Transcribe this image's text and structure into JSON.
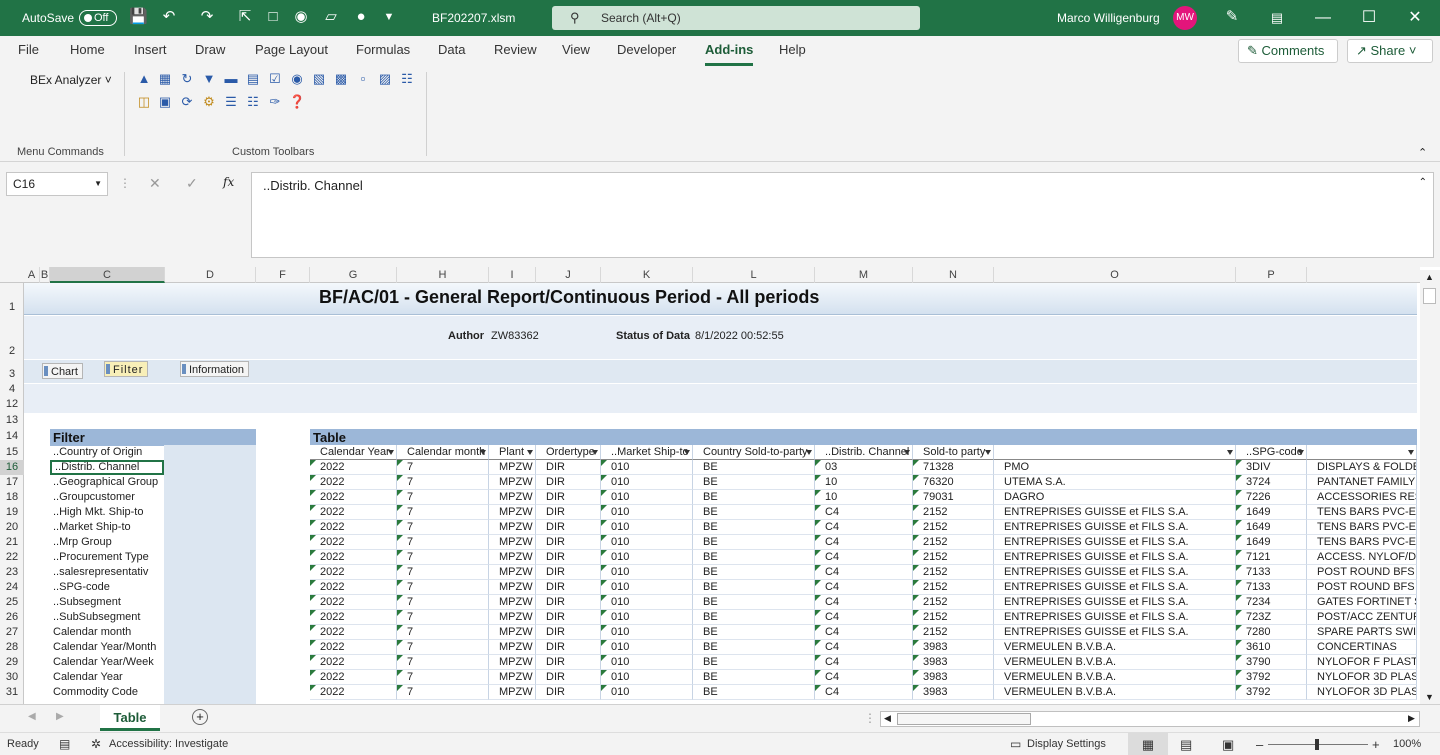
{
  "titlebar": {
    "autosave": "AutoSave",
    "autosave_state": "Off",
    "filename": "BF202207.xlsm",
    "search": "Search (Alt+Q)",
    "user": "Marco Willigenburg",
    "initials": "MW"
  },
  "ribbon": {
    "tabs": [
      "File",
      "Home",
      "Insert",
      "Draw",
      "Page Layout",
      "Formulas",
      "Data",
      "Review",
      "View",
      "Developer",
      "Add-ins",
      "Help"
    ],
    "active_tab": "Add-ins",
    "comments": "Comments",
    "share": "Share",
    "bex": "BEx Analyzer",
    "group1": "Menu Commands",
    "group2": "Custom Toolbars"
  },
  "formula": {
    "namebox": "C16",
    "content": "..Distrib. Channel"
  },
  "columns": [
    "A",
    "B",
    "C",
    "D",
    "F",
    "G",
    "H",
    "I",
    "J",
    "K",
    "L",
    "M",
    "N",
    "O",
    "P"
  ],
  "rows": [
    "1",
    "2",
    "3",
    "4",
    "12",
    "13",
    "14",
    "15",
    "16",
    "17",
    "18",
    "19",
    "20",
    "21",
    "22",
    "23",
    "24",
    "25",
    "26",
    "27",
    "28",
    "29",
    "30",
    "31"
  ],
  "report": {
    "title": "BF/AC/01 - General Report/Continuous Period - All periods",
    "author_label": "Author",
    "author": "ZW83362",
    "status_label": "Status of Data",
    "status": "8/1/2022 00:52:55",
    "buttons": [
      "Chart",
      "Filter",
      "Information"
    ]
  },
  "filter": {
    "heading": "Filter",
    "items": [
      "..Country of Origin",
      "..Distrib. Channel",
      "..Geographical Group",
      "..Groupcustomer",
      "..High Mkt. Ship-to",
      "..Market Ship-to",
      "..Mrp Group",
      "..Procurement Type",
      "..salesrepresentativ",
      "..SPG-code",
      "..Subsegment",
      "..SubSubsegment",
      "Calendar month",
      "Calendar Year/Month",
      "Calendar Year/Week",
      "Calendar Year",
      "Commodity Code"
    ]
  },
  "table": {
    "heading": "Table",
    "headers": [
      "Calendar Year",
      "Calendar month",
      "Plant",
      "Ordertype",
      "..Market Ship-to",
      "Country Sold-to-party",
      "..Distrib. Channel",
      "Sold-to party",
      "",
      "..SPG-code",
      ""
    ],
    "rows": [
      [
        "2022",
        "7",
        "MPZW",
        "DIR",
        "010",
        "BE",
        "03",
        "71328",
        "PMO",
        "3DIV",
        "DISPLAYS & FOLDE"
      ],
      [
        "2022",
        "7",
        "MPZW",
        "DIR",
        "010",
        "BE",
        "10",
        "76320",
        "UTEMA S.A.",
        "3724",
        "PANTANET FAMILY"
      ],
      [
        "2022",
        "7",
        "MPZW",
        "DIR",
        "010",
        "BE",
        "10",
        "79031",
        "DAGRO",
        "7226",
        "ACCESSORIES RESI"
      ],
      [
        "2022",
        "7",
        "MPZW",
        "DIR",
        "010",
        "BE",
        "C4",
        "2152",
        "ENTREPRISES GUISSE et FILS S.A.",
        "1649",
        "TENS BARS PVC-EX"
      ],
      [
        "2022",
        "7",
        "MPZW",
        "DIR",
        "010",
        "BE",
        "C4",
        "2152",
        "ENTREPRISES GUISSE et FILS S.A.",
        "1649",
        "TENS BARS PVC-EX"
      ],
      [
        "2022",
        "7",
        "MPZW",
        "DIR",
        "010",
        "BE",
        "C4",
        "2152",
        "ENTREPRISES GUISSE et FILS S.A.",
        "1649",
        "TENS BARS PVC-EX"
      ],
      [
        "2022",
        "7",
        "MPZW",
        "DIR",
        "010",
        "BE",
        "C4",
        "2152",
        "ENTREPRISES GUISSE et FILS S.A.",
        "7121",
        "ACCESS. NYLOF/DE"
      ],
      [
        "2022",
        "7",
        "MPZW",
        "DIR",
        "010",
        "BE",
        "C4",
        "2152",
        "ENTREPRISES GUISSE et FILS S.A.",
        "7133",
        "POST ROUND BFS"
      ],
      [
        "2022",
        "7",
        "MPZW",
        "DIR",
        "010",
        "BE",
        "C4",
        "2152",
        "ENTREPRISES GUISSE et FILS S.A.",
        "7133",
        "POST ROUND BFS"
      ],
      [
        "2022",
        "7",
        "MPZW",
        "DIR",
        "010",
        "BE",
        "C4",
        "2152",
        "ENTREPRISES GUISSE et FILS S.A.",
        "7234",
        "GATES FORTINET SE"
      ],
      [
        "2022",
        "7",
        "MPZW",
        "DIR",
        "010",
        "BE",
        "C4",
        "2152",
        "ENTREPRISES GUISSE et FILS S.A.",
        "723Z",
        "POST/ACC ZENTURO"
      ],
      [
        "2022",
        "7",
        "MPZW",
        "DIR",
        "010",
        "BE",
        "C4",
        "2152",
        "ENTREPRISES GUISSE et FILS S.A.",
        "7280",
        "SPARE PARTS SWIN"
      ],
      [
        "2022",
        "7",
        "MPZW",
        "DIR",
        "010",
        "BE",
        "C4",
        "3983",
        "VERMEULEN B.V.B.A.",
        "3610",
        "CONCERTINAS"
      ],
      [
        "2022",
        "7",
        "MPZW",
        "DIR",
        "010",
        "BE",
        "C4",
        "3983",
        "VERMEULEN B.V.B.A.",
        "3790",
        "NYLOFOR F PLAST"
      ],
      [
        "2022",
        "7",
        "MPZW",
        "DIR",
        "010",
        "BE",
        "C4",
        "3983",
        "VERMEULEN B.V.B.A.",
        "3792",
        "NYLOFOR 3D PLAST"
      ],
      [
        "2022",
        "7",
        "MPZW",
        "DIR",
        "010",
        "BE",
        "C4",
        "3983",
        "VERMEULEN B.V.B.A.",
        "3792",
        "NYLOFOR 3D PLAST"
      ]
    ]
  },
  "sheet": {
    "tab": "Table"
  },
  "status": {
    "ready": "Ready",
    "accessibility": "Accessibility: Investigate",
    "display": "Display Settings",
    "zoom": "100%"
  }
}
